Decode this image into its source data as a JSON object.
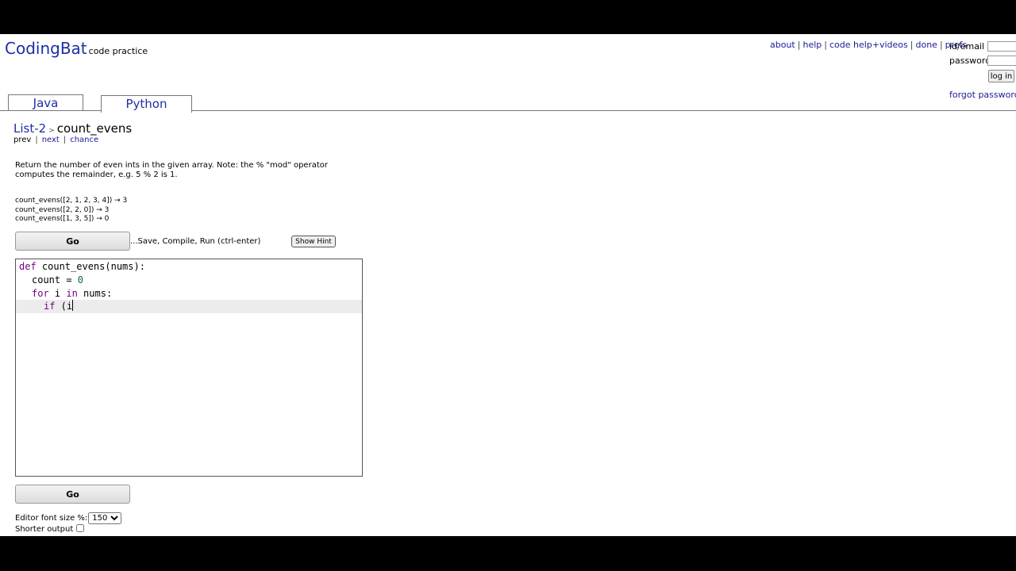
{
  "header": {
    "logo": "CodingBat",
    "logo_sub": "code practice",
    "links": [
      "about",
      "help",
      "code help+videos",
      "done",
      "prefs"
    ]
  },
  "login": {
    "id_label": "id/email",
    "password_label": "password",
    "button": "log in",
    "forgot": "forgot password |"
  },
  "tabs": [
    {
      "label": "Java",
      "active": false
    },
    {
      "label": "Python",
      "active": true
    }
  ],
  "breadcrumb": {
    "category": "List-2",
    "separator": ">",
    "problem": "count_evens"
  },
  "nav": {
    "prev": "prev",
    "next": "next",
    "chance": "chance"
  },
  "problem": {
    "description": "Return the number of even ints in the given array. Note: the % \"mod\" operator computes the remainder, e.g. 5 % 2 is 1.",
    "examples": [
      "count_evens([2, 1, 2, 3, 4]) → 3",
      "count_evens([2, 2, 0]) → 3",
      "count_evens([1, 3, 5]) → 0"
    ]
  },
  "toolbar": {
    "go_label": "Go",
    "go_hint": "...Save, Compile, Run (ctrl-enter)",
    "hint_label": "Show Hint"
  },
  "editor": {
    "lines": [
      {
        "indent": "",
        "kw": "def",
        "text": " count_evens(nums):"
      },
      {
        "indent": "  ",
        "kw": "",
        "text": "count = ",
        "num": "0"
      },
      {
        "indent": "  ",
        "kw": "for",
        "text": " i ",
        "kw2": "in",
        "text2": " nums:"
      },
      {
        "indent": "    ",
        "kw": "if",
        "text": " (i"
      }
    ]
  },
  "footer": {
    "font_size_label": "Editor font size %:",
    "font_size_value": "150",
    "shorter_output_label": "Shorter output"
  }
}
